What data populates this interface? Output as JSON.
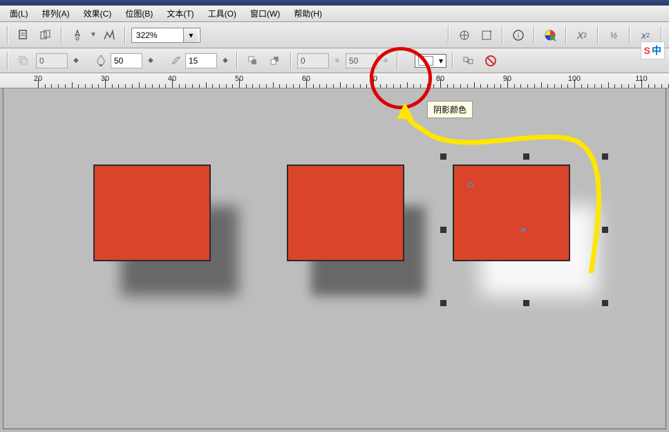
{
  "menubar": {
    "items": [
      {
        "label": "面(L)"
      },
      {
        "label": "排列(A)"
      },
      {
        "label": "效果(C)"
      },
      {
        "label": "位图(B)"
      },
      {
        "label": "文本(T)"
      },
      {
        "label": "工具(O)"
      },
      {
        "label": "窗口(W)"
      },
      {
        "label": "帮助(H)"
      }
    ]
  },
  "toolbar1": {
    "zoom": "322%"
  },
  "toolbar2": {
    "field1": "0",
    "field2": "50",
    "field3": "15",
    "field4": "0",
    "field5": "50"
  },
  "ruler": {
    "labels": [
      "20",
      "30",
      "40",
      "50",
      "60",
      "70",
      "80",
      "90",
      "100",
      "110"
    ]
  },
  "tooltip": {
    "text": "阴影颜色"
  },
  "ime": {
    "s": "S",
    "z": "中"
  },
  "colors": {
    "rect": "#d9442b",
    "highlight": "#d00",
    "arrow": "#ffe600"
  }
}
